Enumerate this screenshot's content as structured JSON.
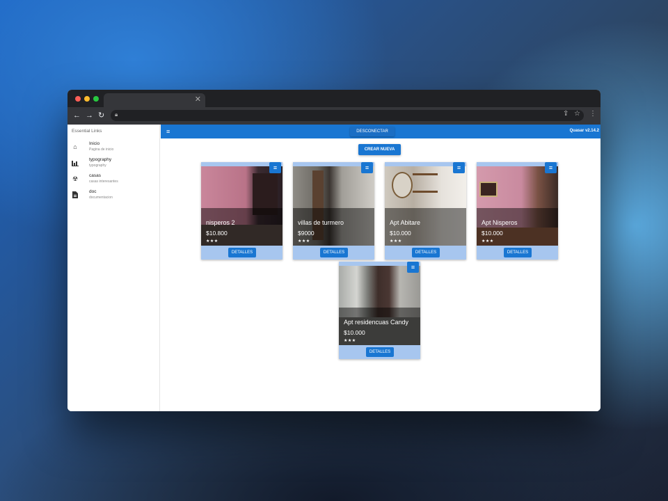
{
  "drawer": {
    "header": "Essential Links",
    "items": [
      {
        "label": "Inicio",
        "caption": "Pagina de inicio",
        "icon": "home-icon"
      },
      {
        "label": "typography",
        "caption": "typography",
        "icon": "bar-chart-icon"
      },
      {
        "label": "casas",
        "caption": "casas interesantes",
        "icon": "casas-icon"
      },
      {
        "label": "doc",
        "caption": "documentacion",
        "icon": "doc-icon"
      }
    ]
  },
  "toolbar": {
    "logout_label": "DESCONECTAR",
    "version": "Quasar v2.14.2"
  },
  "main": {
    "create_label": "CREAR NUEVA",
    "cards": [
      {
        "title": "nisperos 2",
        "price": "$10.800",
        "rating": "★★★",
        "details_label": "DETALLES"
      },
      {
        "title": "villas de turmero",
        "price": "$9000",
        "rating": "★★★",
        "details_label": "DETALLES"
      },
      {
        "title": "Apt Abitare",
        "price": "$10.000",
        "rating": "★★★",
        "details_label": "DETALLES"
      },
      {
        "title": "Apt Nisperos",
        "price": "$10.000",
        "rating": "★★★",
        "details_label": "DETALLES"
      },
      {
        "title": "Apt residencuas Candy",
        "price": "$10.000",
        "rating": "★★★",
        "details_label": "DETALLES"
      }
    ]
  },
  "colors": {
    "primary": "#1976d2",
    "card_bg": "#a7c6ef"
  }
}
